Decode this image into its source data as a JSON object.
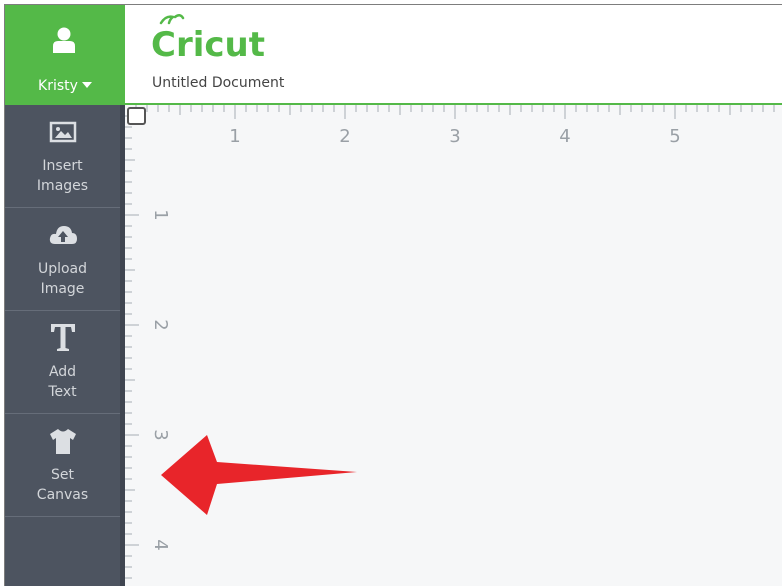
{
  "user": {
    "name": "Kristy",
    "avatar_icon": "user-icon",
    "menu_icon": "caret-down-icon"
  },
  "sidebar": {
    "items": [
      {
        "label_line1": "Insert",
        "label_line2": "Images",
        "icon": "image-icon"
      },
      {
        "label_line1": "Upload",
        "label_line2": "Image",
        "icon": "cloud-upload-icon"
      },
      {
        "label_line1": "Add",
        "label_line2": "Text",
        "icon": "text-t-icon"
      },
      {
        "label_line1": "Set",
        "label_line2": "Canvas",
        "icon": "tshirt-icon"
      }
    ]
  },
  "header": {
    "logo_text": "Cricut",
    "document_title": "Untitled Document"
  },
  "canvas": {
    "ruler_top_labels": [
      "1",
      "2",
      "3",
      "4",
      "5"
    ],
    "ruler_left_labels": [
      "1",
      "2",
      "3",
      "4"
    ]
  },
  "colors": {
    "brand_green": "#54b948",
    "sidebar_bg": "#4d5460",
    "canvas_bg": "#f6f7f8",
    "arrow": "#e8252a"
  }
}
